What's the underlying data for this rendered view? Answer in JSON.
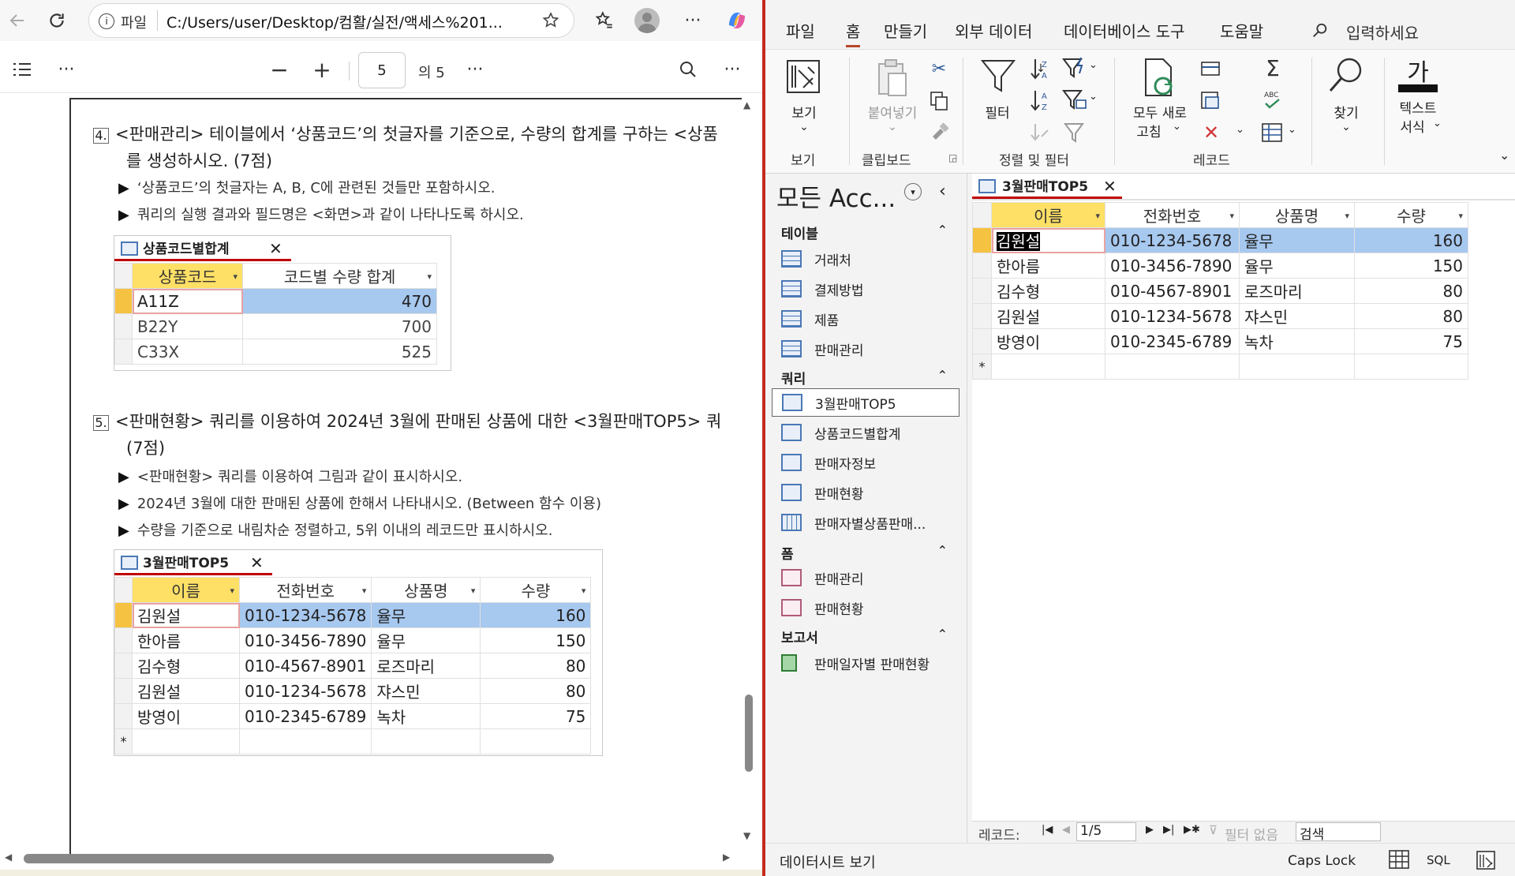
{
  "browser": {
    "address_label": "파일",
    "address": "C:/Users/user/Desktop/컴활/실전/액세스%201...",
    "page_number": "5",
    "page_total": "의 5"
  },
  "doc": {
    "q4_num": "4.",
    "q4_line1": "<판매관리> 테이블에서 ‘상품코드’의 첫글자를 기준으로, 수량의 합계를 구하는 <상품",
    "q4_line2": "를 생성하시오. (7점)",
    "q4_bullets": [
      "‘상품코드’의 첫글자는 A, B, C에 관련된 것들만 포함하시오.",
      "쿼리의 실행 결과와 필드명은 <화면>과 같이 나타나도록 하시오."
    ],
    "t1": {
      "tab": "상품코드별합계",
      "headers": [
        "상품코드",
        "코드별 수량 합계"
      ],
      "rows": [
        [
          "A11Z",
          "470"
        ],
        [
          "B22Y",
          "700"
        ],
        [
          "C33X",
          "525"
        ]
      ]
    },
    "q5_num": "5.",
    "q5_line1": "<판매현황> 쿼리를 이용하여 2024년 3월에 판매된 상품에 대한 <3월판매TOP5> 쿼",
    "q5_line2": "(7점)",
    "q5_bullets": [
      "<판매현황> 쿼리를 이용하여 그림과 같이 표시하시오.",
      "2024년 3월에 대한 판매된 상품에 한해서 나타내시오. (Between 함수 이용)",
      "수량을 기준으로 내림차순 정렬하고, 5위 이내의 레코드만 표시하시오."
    ],
    "t2": {
      "tab": "3월판매TOP5",
      "headers": [
        "이름",
        "전화번호",
        "상품명",
        "수량"
      ],
      "rows": [
        [
          "김원설",
          "010-1234-5678",
          "율무",
          "160"
        ],
        [
          "한아름",
          "010-3456-7890",
          "율무",
          "150"
        ],
        [
          "김수형",
          "010-4567-8901",
          "로즈마리",
          "80"
        ],
        [
          "김원설",
          "010-1234-5678",
          "쟈스민",
          "80"
        ],
        [
          "방영이",
          "010-2345-6789",
          "녹차",
          "75"
        ]
      ],
      "new_row": "*"
    }
  },
  "access": {
    "menus": [
      "파일",
      "홈",
      "만들기",
      "외부 데이터",
      "데이터베이스 도구",
      "도움말"
    ],
    "search_placeholder": "입력하세요",
    "ribbon": {
      "view": "보기",
      "paste": "붙여넣기",
      "filter": "필터",
      "refresh_line1": "모두 새로",
      "refresh_line2": "고침",
      "find": "찾기",
      "text_format_icon": "가",
      "text_format_line1": "텍스트",
      "text_format_line2": "서식",
      "groups": [
        "보기",
        "클립보드",
        "정렬 및 필터",
        "레코드"
      ]
    },
    "nav": {
      "title": "모든 Acc...",
      "sections": [
        {
          "title": "테이블",
          "items": [
            "거래처",
            "결제방법",
            "제품",
            "판매관리"
          ]
        },
        {
          "title": "쿼리",
          "items": [
            "3월판매TOP5",
            "상품코드별합계",
            "판매자정보",
            "판매현황",
            "판매자별상품판매..."
          ]
        },
        {
          "title": "폼",
          "items": [
            "판매관리",
            "판매현황"
          ]
        },
        {
          "title": "보고서",
          "items": [
            "판매일자별 판매현황"
          ]
        }
      ]
    },
    "sheet": {
      "tab": "3월판매TOP5",
      "headers": [
        "이름",
        "전화번호",
        "상품명",
        "수량"
      ],
      "rows": [
        [
          "김원설",
          "010-1234-5678",
          "율무",
          "160"
        ],
        [
          "한아름",
          "010-3456-7890",
          "율무",
          "150"
        ],
        [
          "김수형",
          "010-4567-8901",
          "로즈마리",
          "80"
        ],
        [
          "김원설",
          "010-1234-5678",
          "쟈스민",
          "80"
        ],
        [
          "방영이",
          "010-2345-6789",
          "녹차",
          "75"
        ]
      ],
      "new_row": "*"
    },
    "record_nav": {
      "label": "레코드:",
      "current": "1/5",
      "filter": "필터 없음",
      "search": "검색"
    },
    "status": {
      "view": "데이터시트 보기",
      "caps": "Caps Lock",
      "sql": "SQL"
    }
  }
}
